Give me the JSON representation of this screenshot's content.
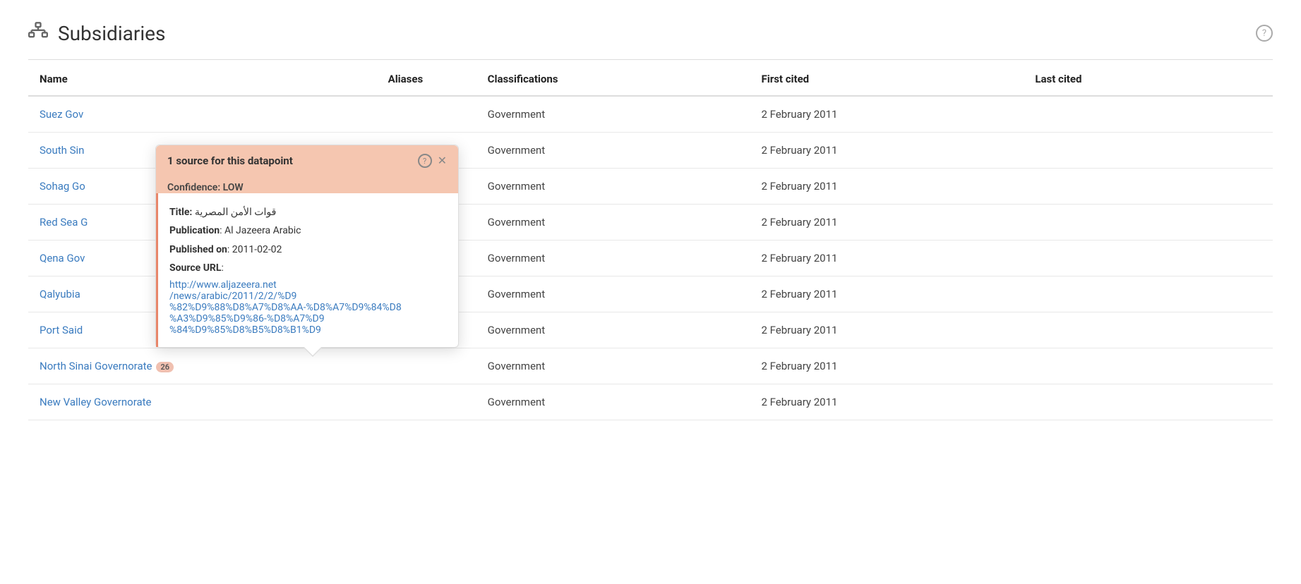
{
  "page": {
    "title": "Subsidiaries",
    "help_label": "?"
  },
  "header": {
    "icon": "🏢"
  },
  "table": {
    "columns": [
      "Name",
      "Aliases",
      "Classifications",
      "First cited",
      "Last cited"
    ],
    "rows": [
      {
        "name": "Suez Gov",
        "name_suffix": "",
        "badge": null,
        "classification": "Government",
        "first_cited": "2 February 2011",
        "last_cited": ""
      },
      {
        "name": "South Sin",
        "name_suffix": "",
        "badge": null,
        "classification": "Government",
        "first_cited": "2 February 2011",
        "last_cited": ""
      },
      {
        "name": "Sohag Go",
        "name_suffix": "",
        "badge": null,
        "classification": "Government",
        "first_cited": "2 February 2011",
        "last_cited": ""
      },
      {
        "name": "Red Sea G",
        "name_suffix": "",
        "badge": null,
        "classification": "Government",
        "first_cited": "2 February 2011",
        "last_cited": ""
      },
      {
        "name": "Qena Gov",
        "name_suffix": "",
        "badge": null,
        "classification": "Government",
        "first_cited": "2 February 2011",
        "last_cited": ""
      },
      {
        "name": "Qalyubia",
        "name_suffix": "",
        "badge": null,
        "classification": "Government",
        "first_cited": "2 February 2011",
        "last_cited": ""
      },
      {
        "name": "Port Said",
        "name_suffix": "",
        "badge": null,
        "classification": "Government",
        "first_cited": "2 February 2011",
        "last_cited": ""
      },
      {
        "name": "North Sinai Governorate",
        "name_suffix": "",
        "badge": "26",
        "classification": "Government",
        "first_cited": "2 February 2011",
        "last_cited": ""
      },
      {
        "name": "New Valley Governorate",
        "name_suffix": "",
        "badge": null,
        "classification": "Government",
        "first_cited": "2 February 2011",
        "last_cited": ""
      }
    ]
  },
  "popover": {
    "header_title": "1 source for this datapoint",
    "confidence_label": "Confidence:",
    "confidence_value": "LOW",
    "title_label": "Title:",
    "title_value": "قوات الأمن المصرية",
    "publication_label": "Publication",
    "publication_value": "Al Jazeera Arabic",
    "published_on_label": "Published on",
    "published_on_value": "2011-02-02",
    "source_url_label": "Source URL",
    "source_url": "http://www.aljazeera.net/news/arabic/2011/2/2/%D9%82%D9%88%D8%A7%D8%AA-%D8%A7%D9%84%D8%A3%D9%85%D9%86-%D8%A7%D9%84%D9%85%D8%B5%D8%B1%D9%8A%D8%A9",
    "source_url_display": "http://www.aljazeera.net\n/news/arabic/2011/2/2/%D9\n%82%D9%88%D8%A7%D8%AA-%D8%A7%D9%84%D8\n%A3%D9%85%D9%86-%D8%A7%D9\n%84%D9%85%D8%B5%D8%B1%D9"
  }
}
